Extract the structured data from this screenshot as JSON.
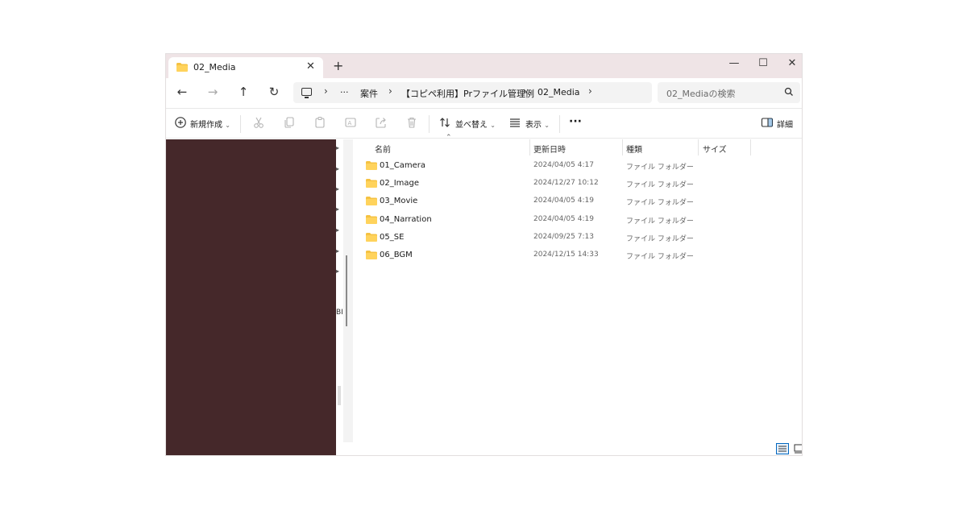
{
  "tab": {
    "title": "02_Media"
  },
  "window_controls": {
    "minimize": "—",
    "maximize": "☐",
    "close": "✕"
  },
  "nav": {
    "back": "←",
    "forward": "→",
    "up": "↑",
    "refresh": "↻"
  },
  "breadcrumb": {
    "sep": "›",
    "more": "···",
    "items": [
      "案件",
      "【コピペ利用】Prファイル管理例",
      "02_Media"
    ]
  },
  "search": {
    "placeholder": "02_Mediaの検索"
  },
  "toolbar": {
    "new_label": "新規作成",
    "sort_label": "並べ替え",
    "view_label": "表示",
    "more_label": "···",
    "details_label": "詳細"
  },
  "navpane": {
    "cut_text": "BI"
  },
  "columns": {
    "name": "名前",
    "date": "更新日時",
    "type": "種類",
    "size": "サイズ"
  },
  "rows": [
    {
      "name": "01_Camera",
      "date": "2024/04/05 4:17",
      "type": "ファイル フォルダー"
    },
    {
      "name": "02_Image",
      "date": "2024/12/27 10:12",
      "type": "ファイル フォルダー"
    },
    {
      "name": "03_Movie",
      "date": "2024/04/05 4:19",
      "type": "ファイル フォルダー"
    },
    {
      "name": "04_Narration",
      "date": "2024/04/05 4:19",
      "type": "ファイル フォルダー"
    },
    {
      "name": "05_SE",
      "date": "2024/09/25 7:13",
      "type": "ファイル フォルダー"
    },
    {
      "name": "06_BGM",
      "date": "2024/12/15 14:33",
      "type": "ファイル フォルダー"
    }
  ],
  "colors": {
    "folder": "#f5c242",
    "accent": "#0067c0",
    "nav_pane": "#45282a",
    "titlebar": "#efe4e6"
  }
}
